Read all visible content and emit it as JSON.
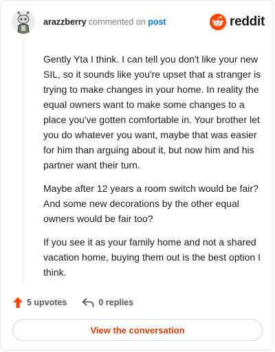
{
  "header": {
    "username": "arazzberry",
    "action_text": "commented on",
    "post_link": "post",
    "brand": "reddit"
  },
  "comment": {
    "paragraphs": [
      "Gently Yta I think. I can tell you don't like your new SIL, so it sounds like you're upset that a stranger is trying to make changes in your home. In reality the equal owners want to make some changes to a place you've gotten comfortable in. Your brother let you do whatever you want, maybe that was easier for him than arguing about it, but now him and his partner want their turn.",
      "Maybe after 12 years a room switch would be fair? And some new decorations by the other equal owners would be fair too?",
      "If you see it as your family home and not a shared vacation home, buying them out is the best option I think."
    ]
  },
  "actions": {
    "upvotes": "5 upvotes",
    "replies": "0 replies"
  },
  "footer": {
    "view_button": "View the conversation"
  },
  "colors": {
    "brand_orange": "#ff4500",
    "link_blue": "#0079d3",
    "button_text": "#d93a00"
  },
  "icons": {
    "avatar": "snoo-avatar",
    "brand": "reddit-logo-icon",
    "upvote": "upvote-arrow-icon",
    "reply": "reply-arrow-icon"
  }
}
